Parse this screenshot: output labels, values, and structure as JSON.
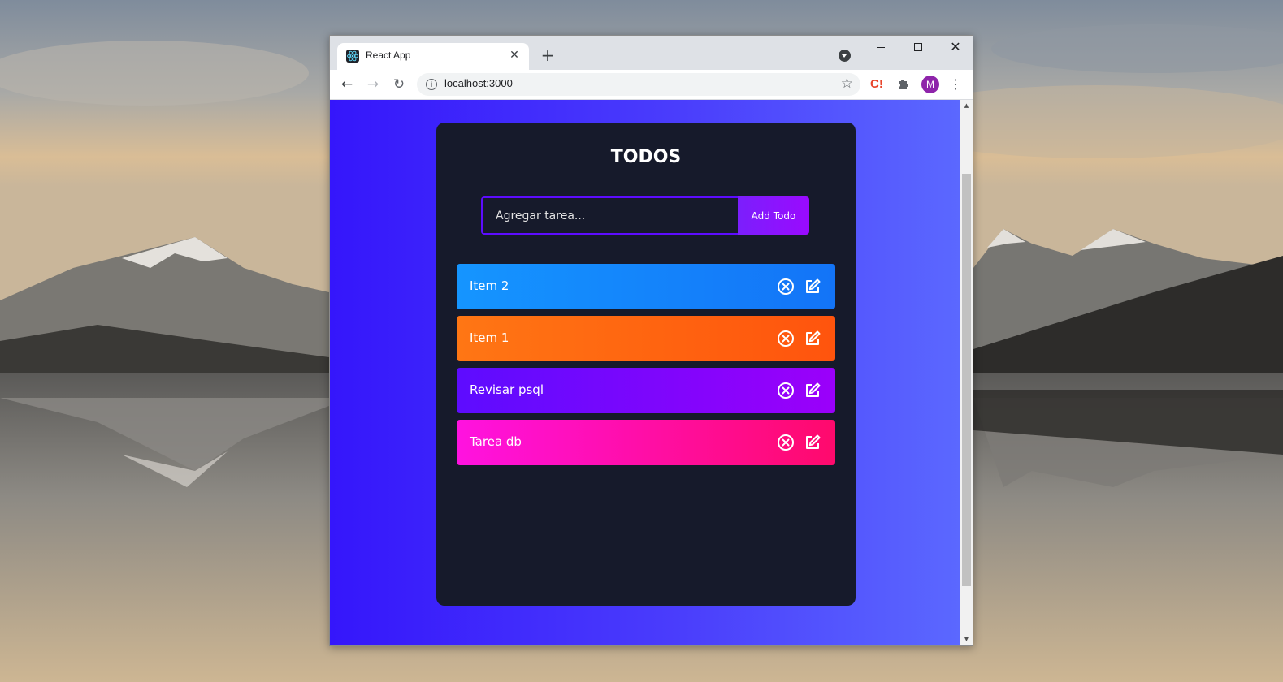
{
  "browser": {
    "tab_title": "React App",
    "url": "localhost:3000",
    "avatar_initial": "M",
    "extension_label": "C!"
  },
  "app": {
    "title": "TODOS",
    "input_placeholder": "Agregar tarea...",
    "input_value": "",
    "add_button_label": "Add Todo",
    "todos": [
      {
        "text": "Item 2",
        "gradient": [
          "#1595ff",
          "#1374f7"
        ]
      },
      {
        "text": "Item 1",
        "gradient": [
          "#ff7614",
          "#ff540d"
        ]
      },
      {
        "text": "Revisar psql",
        "gradient": [
          "#5d0cff",
          "#9b00fa"
        ]
      },
      {
        "text": "Tarea db",
        "gradient": [
          "#ff12e0",
          "#ff0a6c"
        ]
      }
    ]
  },
  "colors": {
    "page_gradient": [
      "#3516fb",
      "#5b68ff"
    ],
    "panel_bg": "#161a2b",
    "input_border": "#5d0cff"
  }
}
